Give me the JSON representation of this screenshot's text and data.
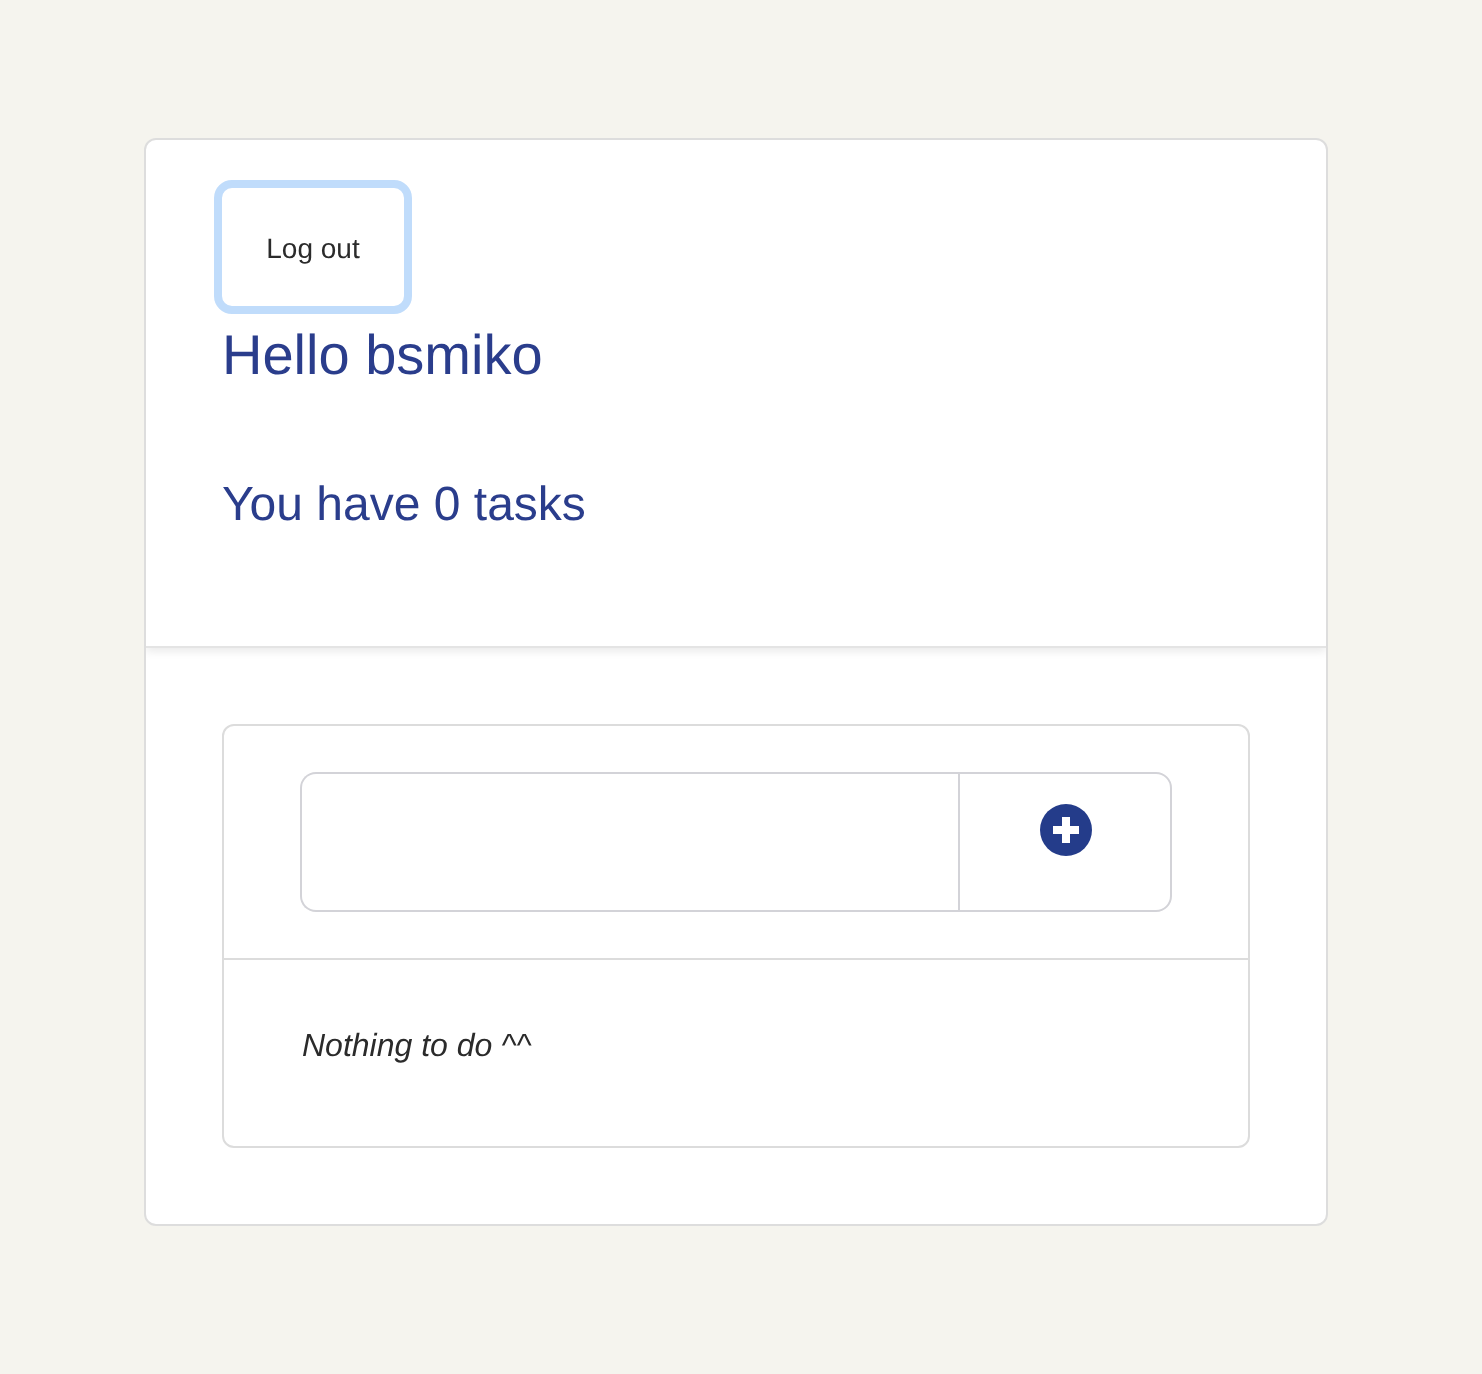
{
  "header": {
    "logout_button": {
      "label": "Log out",
      "focused": true
    },
    "greeting": "Hello bsmiko",
    "task_count": "You have 0 tasks"
  },
  "todo": {
    "empty_message": "Nothing to do ^^"
  }
}
